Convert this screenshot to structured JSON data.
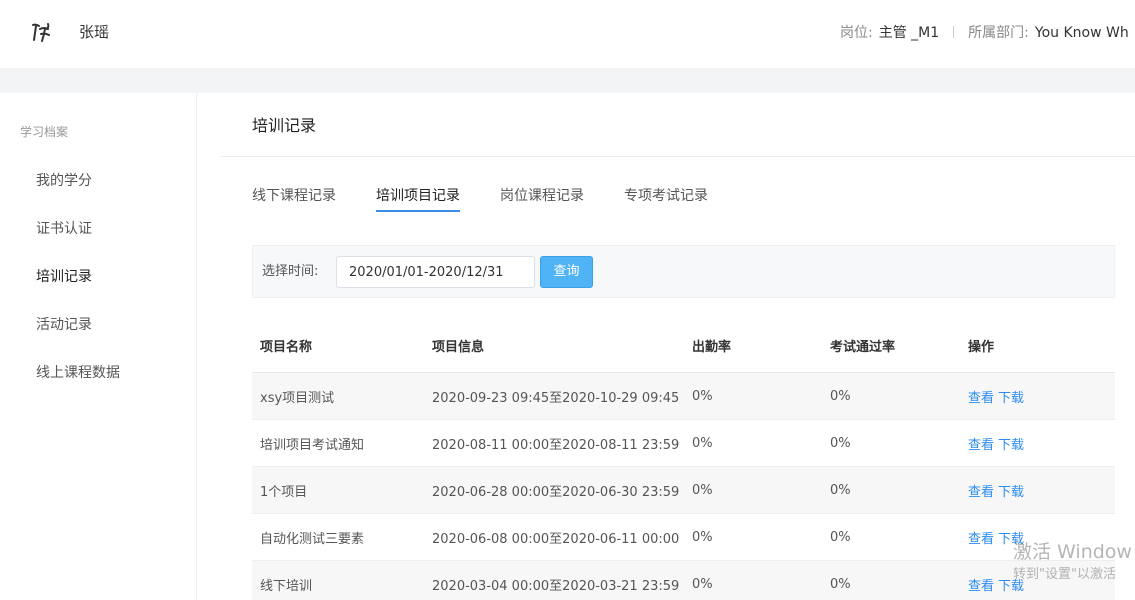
{
  "header": {
    "user_name": "张瑶",
    "position_label": "岗位:",
    "position_value": "主管 _M1",
    "department_label": "所属部门:",
    "department_value": "You Know Wh"
  },
  "sidebar": {
    "title": "学习档案",
    "items": [
      {
        "label": "我的学分",
        "active": false
      },
      {
        "label": "证书认证",
        "active": false
      },
      {
        "label": "培训记录",
        "active": true
      },
      {
        "label": "活动记录",
        "active": false
      },
      {
        "label": "线上课程数据",
        "active": false
      }
    ]
  },
  "main": {
    "title": "培训记录",
    "tabs": [
      {
        "label": "线下课程记录"
      },
      {
        "label": "培训项目记录"
      },
      {
        "label": "岗位课程记录"
      },
      {
        "label": "专项考试记录"
      }
    ],
    "active_tab": 1
  },
  "filter": {
    "label": "选择时间:",
    "date_range": "2020/01/01-2020/12/31",
    "query_label": "查询"
  },
  "table": {
    "columns": [
      "项目名称",
      "项目信息",
      "出勤率",
      "考试通过率",
      "操作"
    ],
    "rows": [
      {
        "name": "xsy项目测试",
        "info": "2020-09-23 09:45至2020-10-29 09:45",
        "attendance": "0%",
        "pass_rate": "0%",
        "view": "查看",
        "download": "下载"
      },
      {
        "name": "培训项目考试通知",
        "info": "2020-08-11 00:00至2020-08-11 23:59",
        "attendance": "0%",
        "pass_rate": "0%",
        "view": "查看",
        "download": "下载"
      },
      {
        "name": "1个项目",
        "info": "2020-06-28 00:00至2020-06-30 23:59",
        "attendance": "0%",
        "pass_rate": "0%",
        "view": "查看",
        "download": "下载"
      },
      {
        "name": "自动化测试三要素",
        "info": "2020-06-08 00:00至2020-06-11 00:00",
        "attendance": "0%",
        "pass_rate": "0%",
        "view": "查看",
        "download": "下载"
      },
      {
        "name": "线下培训",
        "info": "2020-03-04 00:00至2020-03-21 23:59",
        "attendance": "0%",
        "pass_rate": "0%",
        "view": "查看",
        "download": "下载"
      }
    ]
  },
  "watermark": {
    "title": "激活 Window",
    "subtitle": "转到\"设置\"以激活"
  },
  "colors": {
    "accent": "#3a8ee6",
    "button": "#4fb3f6",
    "link": "#2d8cf0",
    "band": "#f3f4f6"
  }
}
